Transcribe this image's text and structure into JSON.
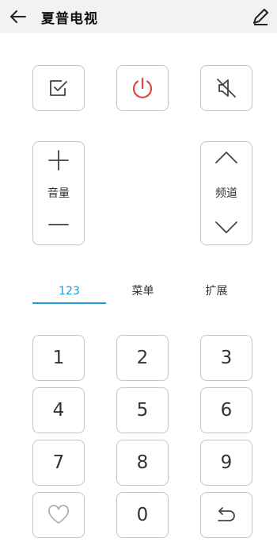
{
  "header": {
    "title": "夏普电视",
    "back_icon": "arrow-left-icon",
    "edit_icon": "pencil-icon"
  },
  "controls": {
    "check_icon": "checkbox-icon",
    "power_icon": "power-icon",
    "power_color": "#e0453e",
    "mute_icon": "mute-icon",
    "volume_label": "音量",
    "channel_label": "频道"
  },
  "tabs": [
    {
      "label": "123",
      "active": true
    },
    {
      "label": "菜单",
      "active": false
    },
    {
      "label": "扩展",
      "active": false
    }
  ],
  "accent_color": "#1b9ad6",
  "keypad": {
    "k1": "1",
    "k2": "2",
    "k3": "3",
    "k4": "4",
    "k5": "5",
    "k6": "6",
    "k7": "7",
    "k8": "8",
    "k9": "9",
    "k0": "0",
    "favorite_icon": "heart-icon",
    "return_icon": "return-icon"
  }
}
